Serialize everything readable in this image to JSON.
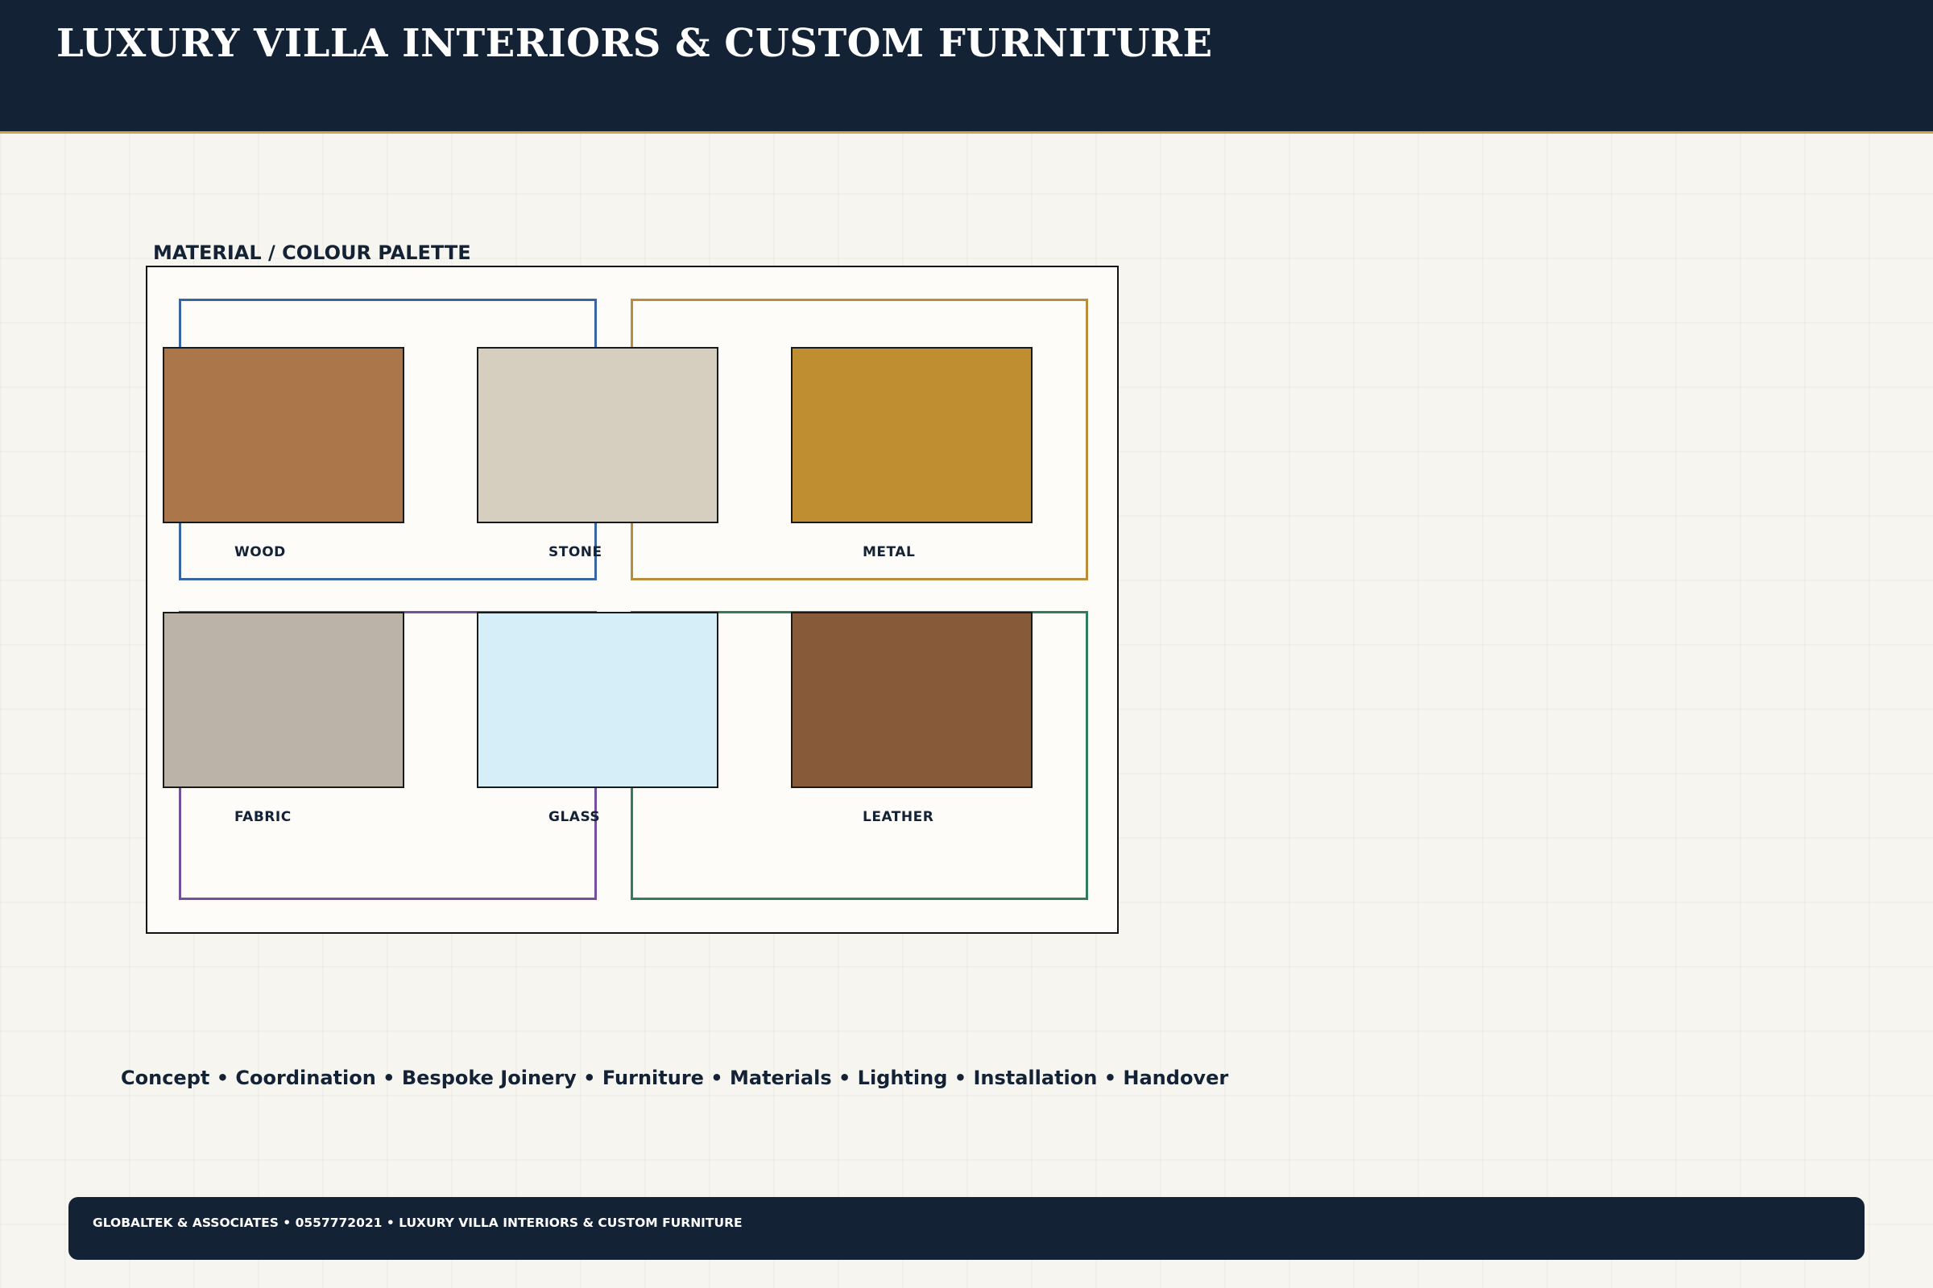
{
  "header": {
    "title": "LUXURY VILLA INTERIORS & CUSTOM FURNITURE"
  },
  "palette": {
    "title": "MATERIAL / COLOUR PALETTE",
    "frame_colors": {
      "blue": "#3a66a0",
      "gold": "#b88d3c",
      "purple": "#74509a",
      "green": "#2f7d5a"
    },
    "swatches": [
      {
        "label": "WOOD",
        "color": "#ab764a"
      },
      {
        "label": "STONE",
        "color": "#d6cfc0"
      },
      {
        "label": "METAL",
        "color": "#be8e31"
      },
      {
        "label": "FABRIC",
        "color": "#bbb2a8"
      },
      {
        "label": "GLASS",
        "color": "#d6eef7"
      },
      {
        "label": "LEATHER",
        "color": "#875b3a"
      }
    ]
  },
  "services": {
    "text": "Concept • Coordination • Bespoke Joinery • Furniture • Materials • Lighting • Installation • Handover"
  },
  "footer": {
    "text": "GLOBALTEK & ASSOCIATES • 0557772021 • LUXURY VILLA INTERIORS & CUSTOM FURNITURE"
  }
}
